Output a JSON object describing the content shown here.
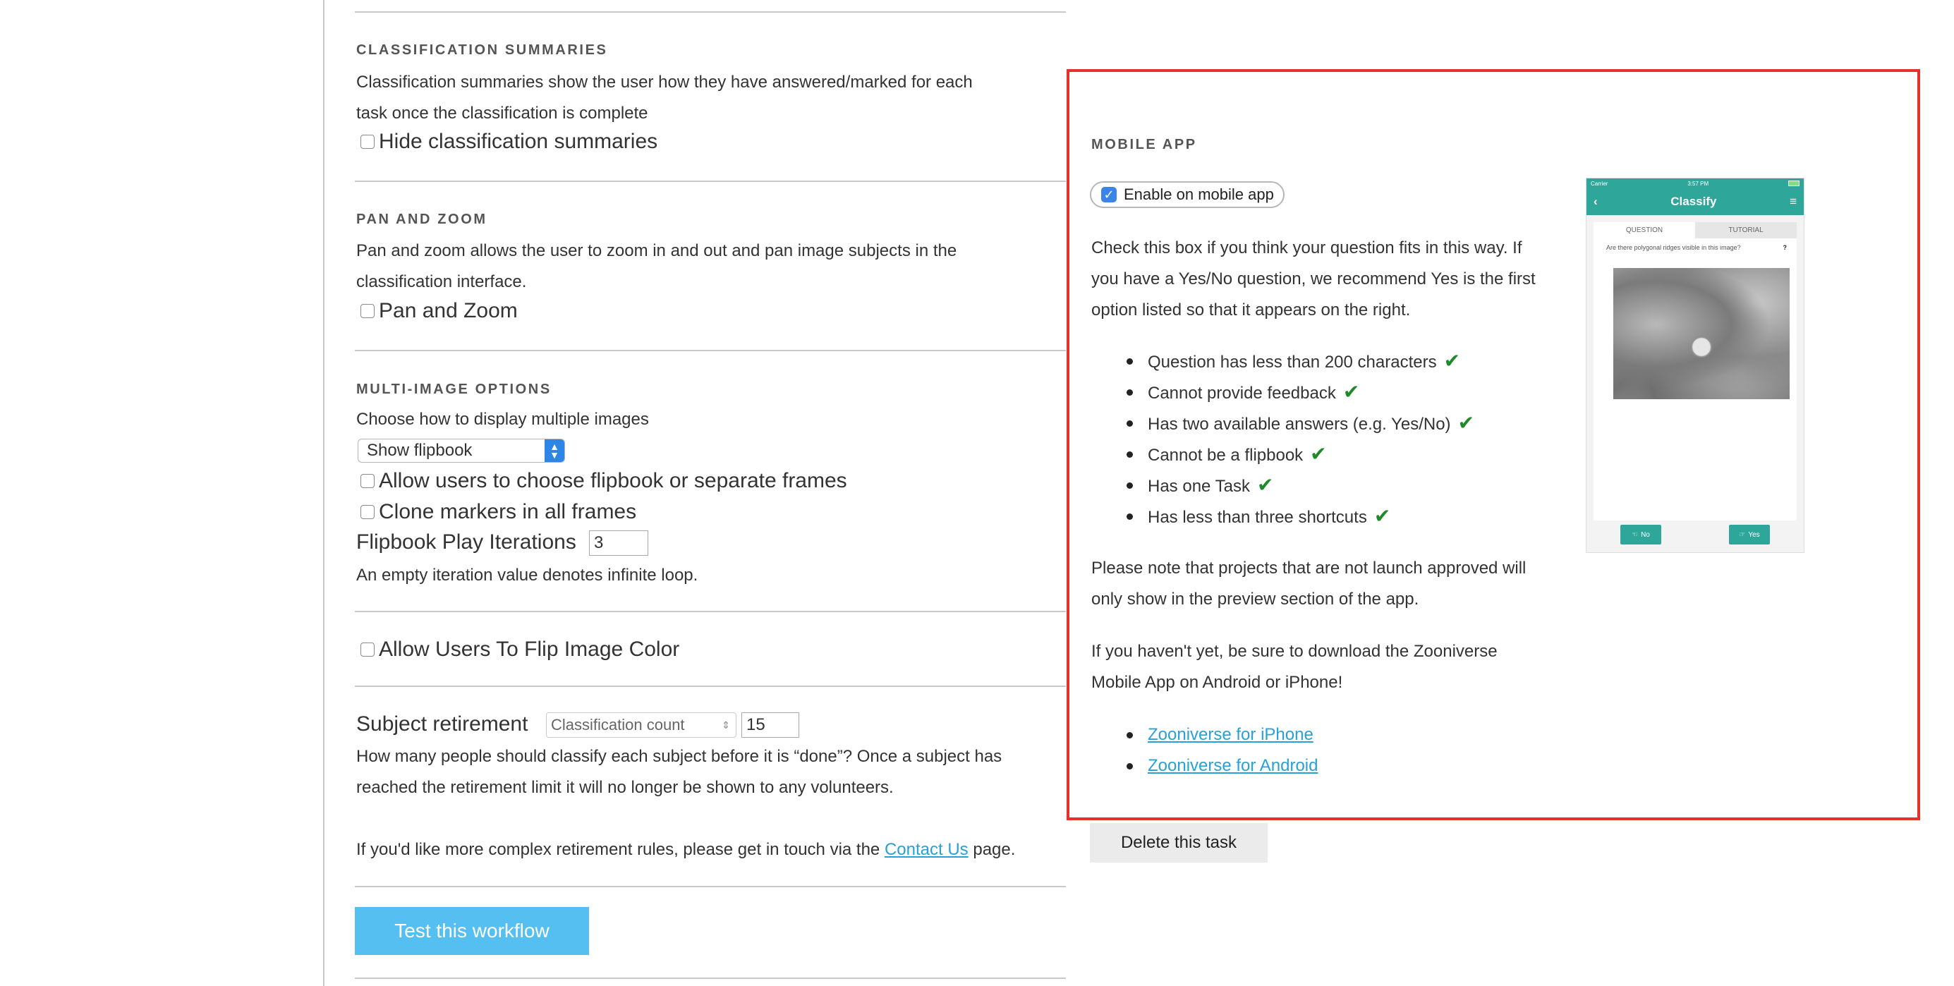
{
  "classification_summaries": {
    "heading": "CLASSIFICATION SUMMARIES",
    "line1": "Classification summaries show the user how they have answered/marked for each",
    "line2": "task once the classification is complete",
    "checkbox_label": "Hide classification summaries"
  },
  "pan_zoom": {
    "heading": "PAN AND ZOOM",
    "line1": "Pan and zoom allows the user to zoom in and out and pan image subjects in the",
    "line2": "classification interface.",
    "checkbox_label": "Pan and Zoom"
  },
  "multi_image": {
    "heading": "MULTI-IMAGE OPTIONS",
    "description": "Choose how to display multiple images",
    "select_value": "Show flipbook",
    "allow_choose_label": "Allow users to choose flipbook or separate frames",
    "clone_markers_label": "Clone markers in all frames",
    "iterations_label": "Flipbook Play Iterations",
    "iterations_value": "3",
    "iterations_note": "An empty iteration value denotes infinite loop."
  },
  "flip_color": {
    "checkbox_label": "Allow Users To Flip Image Color"
  },
  "retirement": {
    "label": "Subject retirement",
    "select_value": "Classification count",
    "count_value": "15",
    "line1": "How many people should classify each subject before it is “done”? Once a subject has",
    "line2": "reached the retirement limit it will no longer be shown to any volunteers.",
    "contact_prefix": "If you'd like more complex retirement rules, please get in touch via the ",
    "contact_link": "Contact Us",
    "contact_suffix": " page."
  },
  "test_button": "Test this workflow",
  "mobile_app": {
    "heading": "MOBILE APP",
    "enable_label": "Enable on mobile app",
    "enabled": true,
    "desc_line1": "Check this box if you think your question fits in this way. If",
    "desc_line2": "you have a Yes/No question, we recommend Yes is the first",
    "desc_line3": "option listed so that it appears on the right.",
    "criteria": [
      "Question has less than 200 characters",
      "Cannot provide feedback",
      "Has two available answers (e.g. Yes/No)",
      "Cannot be a flipbook",
      "Has one Task",
      "Has less than three shortcuts"
    ],
    "note_line1": "Please note that projects that are not launch approved will",
    "note_line2": "only show in the preview section of the app.",
    "download_line1": "If you haven't yet, be sure to download the Zooniverse",
    "download_line2": "Mobile App on Android or iPhone!",
    "links": [
      "Zooniverse for iPhone",
      "Zooniverse for Android"
    ],
    "phone": {
      "carrier": "Carrier",
      "time": "3:57 PM",
      "title": "Classify",
      "tab_question": "QUESTION",
      "tab_tutorial": "TUTORIAL",
      "question": "Are there polygonal ridges visible in this image?",
      "no_label": "No",
      "yes_label": "Yes"
    }
  },
  "delete_button": "Delete this task",
  "colors": {
    "accent_blue": "#56bff1",
    "link": "#2aa0d8",
    "check_green": "#1f8a2a",
    "highlight_red": "#e8302a",
    "teal": "#2fa69a"
  }
}
